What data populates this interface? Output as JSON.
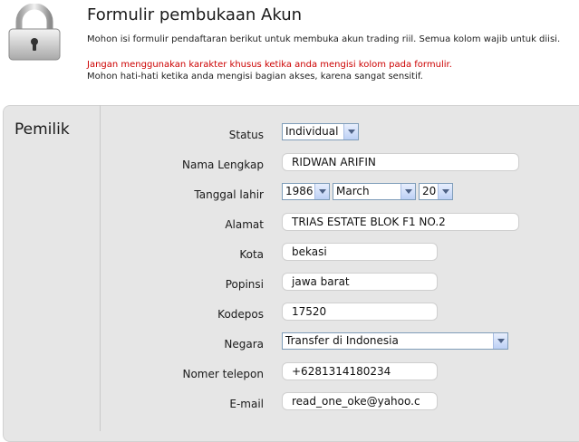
{
  "header": {
    "title": "Formulir pembukaan Akun",
    "intro": "Mohon isi formulir pendaftaran berikut untuk membuka akun trading riil. Semua kolom wajib untuk diisi.",
    "warning": "Jangan menggunakan karakter khusus ketika anda mengisi kolom pada formulir.",
    "note": "Mohon hati-hati ketika anda mengisi bagian akses, karena sangat sensitif."
  },
  "section": {
    "title": "Pemilik"
  },
  "form": {
    "status": {
      "label": "Status",
      "value": "Individual"
    },
    "full_name": {
      "label": "Nama Lengkap",
      "value": "RIDWAN ARIFIN"
    },
    "birth_date": {
      "label": "Tanggal lahir",
      "year": "1986",
      "month": "March",
      "day": "20"
    },
    "address": {
      "label": "Alamat",
      "value": "TRIAS ESTATE BLOK F1 NO.2"
    },
    "city": {
      "label": "Kota",
      "value": "bekasi"
    },
    "province": {
      "label": "Popinsi",
      "value": "jawa barat"
    },
    "postal_code": {
      "label": "Kodepos",
      "value": "17520"
    },
    "country": {
      "label": "Negara",
      "value": "Transfer di Indonesia"
    },
    "phone": {
      "label": "Nomer telepon",
      "value": "+6281314180234"
    },
    "email": {
      "label": "E-mail",
      "value": "read_one_oke@yahoo.c"
    }
  },
  "icons": {
    "header_icon": "padlock-icon"
  },
  "colors": {
    "warning": "#cc0000",
    "panel": "#e6e6e6",
    "select_border": "#7f9db9"
  }
}
